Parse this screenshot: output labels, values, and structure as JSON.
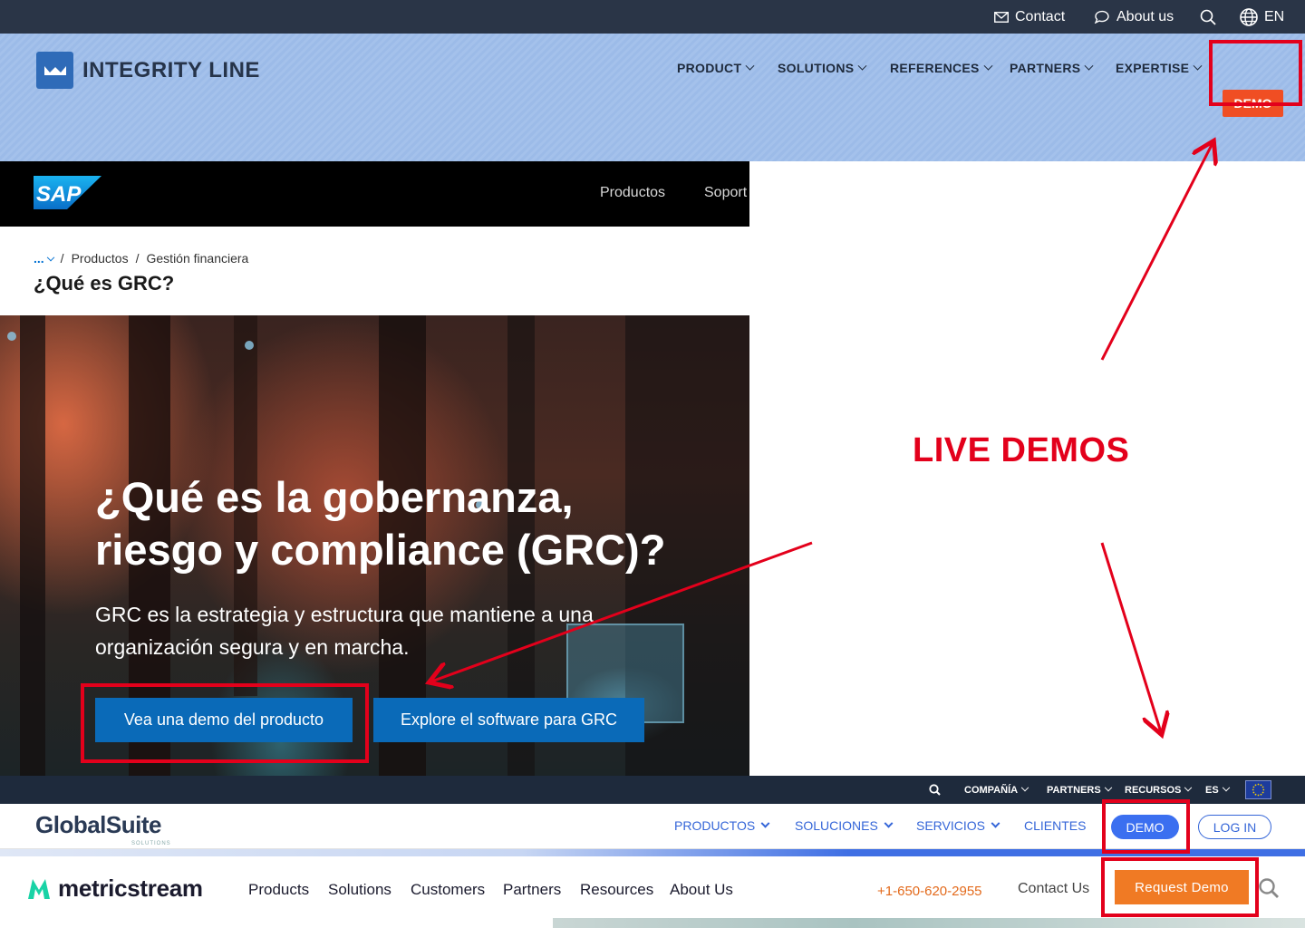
{
  "integrity_line": {
    "topbar": {
      "contact": "Contact",
      "about": "About us",
      "lang": "EN"
    },
    "logo": "INTEGRITY LINE",
    "nav": [
      "PRODUCT",
      "SOLUTIONS",
      "REFERENCES",
      "PARTNERS",
      "EXPERTISE"
    ],
    "demo": "DEMO",
    "colors": {
      "topbar": "#2a3547",
      "header": "#9cbbe8",
      "demo": "#f04e23"
    }
  },
  "sap": {
    "logo": "SAP",
    "nav": [
      "Productos",
      "Soport"
    ],
    "breadcrumb": {
      "ellipsis": "...",
      "items": [
        "Productos",
        "Gestión financiera"
      ]
    },
    "page_title": "¿Qué es GRC?",
    "hero": {
      "heading_line1": "¿Qué es la gobernanza,",
      "heading_line2": "riesgo y compliance (GRC)?",
      "paragraph_line1": "GRC es la estrategia y estructura que mantiene a una",
      "paragraph_line2": "organización segura y en marcha.",
      "btn_demo": "Vea una demo del producto",
      "btn_explore": "Explore el software para GRC"
    },
    "colors": {
      "button": "#0a6ab8"
    }
  },
  "annotation": {
    "label": "LIVE DEMOS",
    "color": "#e3001b"
  },
  "globalsuite": {
    "topbar": [
      "COMPAÑÍA",
      "PARTNERS",
      "RECURSOS",
      "ES"
    ],
    "logo": "GlobalSuite",
    "logo_sub": "SOLUTIONS",
    "nav": [
      "PRODUCTOS",
      "SOLUCIONES",
      "SERVICIOS",
      "CLIENTES"
    ],
    "demo": "DEMO",
    "login": "LOG IN",
    "colors": {
      "accent": "#3b6ff0"
    }
  },
  "metricstream": {
    "logo": "metricstream",
    "nav": [
      "Products",
      "Solutions",
      "Customers",
      "Partners",
      "Resources",
      "About Us"
    ],
    "phone": "+1-650-620-2955",
    "contact": "Contact Us",
    "request_demo": "Request Demo",
    "colors": {
      "accent": "#f07a24",
      "logo": "#19d3a6"
    }
  }
}
